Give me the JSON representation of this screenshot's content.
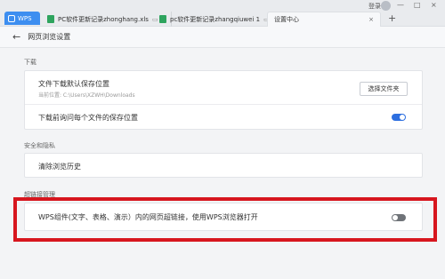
{
  "tabs": {
    "wps_label": "WPS",
    "doc1": "PC软件更新记录zhonghang.xls",
    "doc2": "pc软件更新记录zhangqiuwei 1",
    "settings": "设置中心",
    "close_glyph": "×",
    "add_glyph": "+",
    "mini_glyph": "▭"
  },
  "window": {
    "login": "登录",
    "minimize": "—",
    "maximize": "□",
    "close": "×"
  },
  "header": {
    "back_glyph": "←",
    "title": "网页浏览设置"
  },
  "download": {
    "section_title": "下载",
    "default_location_title": "文件下载默认保存位置",
    "current_location": "当前位置: C:\\Users\\XZWH\\Downloads",
    "choose_folder": "选择文件夹",
    "ask_each_file": "下载前询问每个文件的保存位置",
    "ask_each_file_enabled": true
  },
  "privacy": {
    "section_title": "安全和隐私",
    "clear_history": "清除浏览历史"
  },
  "hyperlink": {
    "section_title": "超链接管理",
    "open_with_wps": "WPS组件(文字、表格、演示）内的网页超链接，使用WPS浏览器打开",
    "open_with_wps_enabled": false
  },
  "colors": {
    "accent": "#3d8ef0",
    "toggle_on": "#2d6fe0",
    "toggle_off": "#6f7378",
    "highlight": "#d7161e"
  }
}
